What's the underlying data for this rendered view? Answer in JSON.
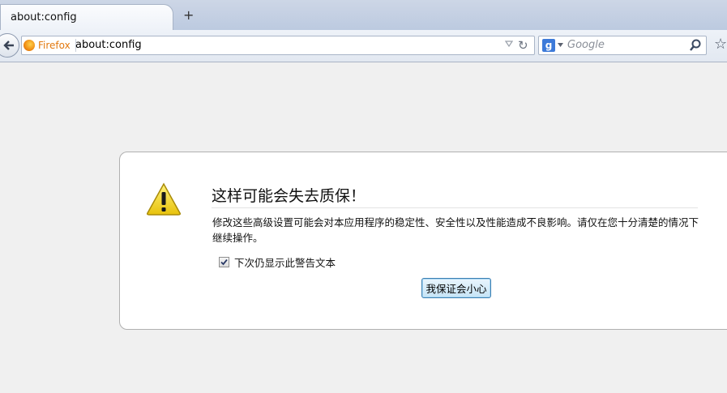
{
  "tab": {
    "title": "about:config",
    "new_tab_symbol": "+"
  },
  "navbar": {
    "identity_label": "Firefox",
    "url": "about:config",
    "search_engine_letter": "g",
    "search_placeholder": "Google"
  },
  "warning": {
    "title": "这样可能会失去质保！",
    "description": "修改这些高级设置可能会对本应用程序的稳定性、安全性以及性能造成不良影响。请仅在您十分清楚的情况下继续操作。",
    "checkbox_label": "下次仍显示此警告文本",
    "checkbox_checked": true,
    "confirm_button": "我保证会小心"
  },
  "icons": [
    "back-arrow-icon",
    "firefox-logo-icon",
    "dropdown-icon",
    "reload-icon",
    "google-icon",
    "search-magnifier-icon",
    "bookmark-star-icon",
    "warning-triangle-icon",
    "checkmark-icon"
  ]
}
